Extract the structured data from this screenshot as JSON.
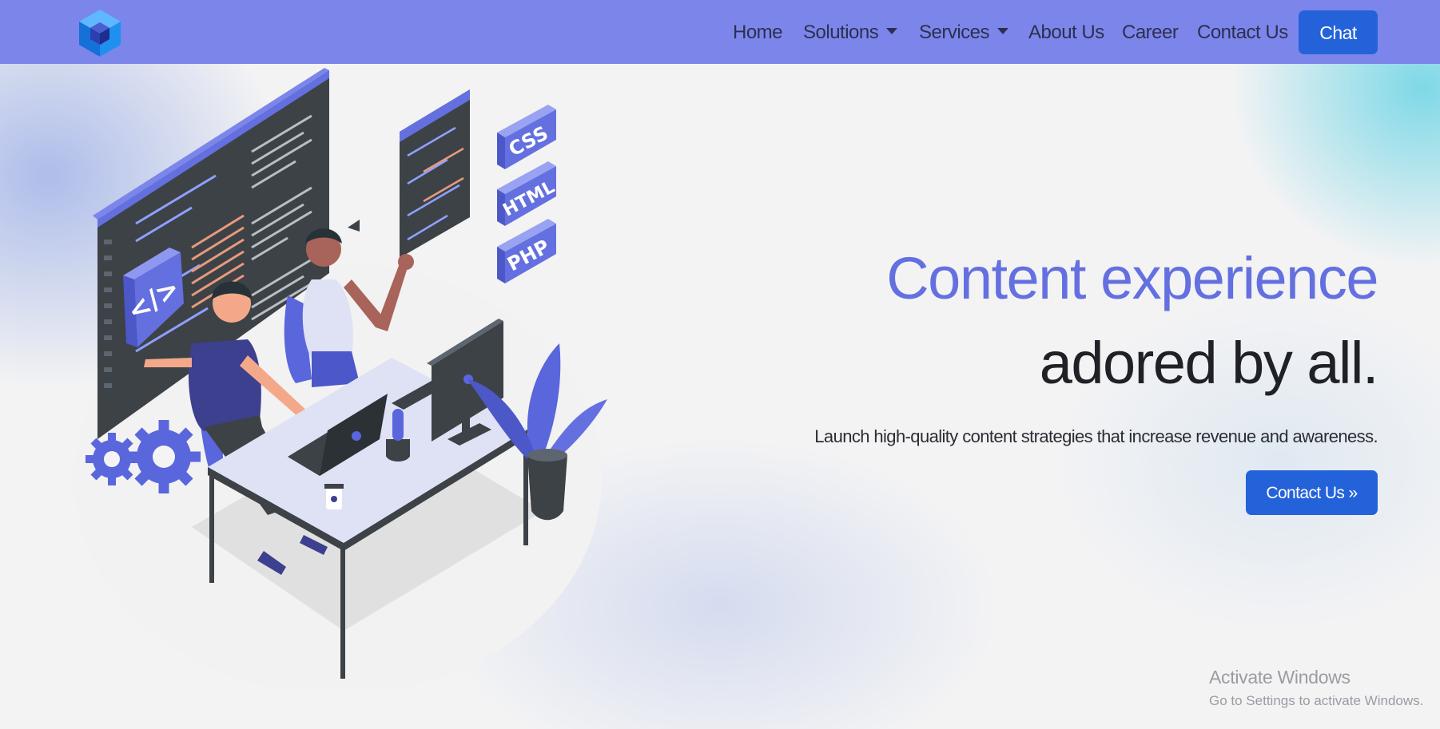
{
  "nav": {
    "links": [
      {
        "label": "Home"
      },
      {
        "label": "Solutions"
      },
      {
        "label": "Services"
      },
      {
        "label": "About Us"
      },
      {
        "label": "Career"
      },
      {
        "label": "Contact Us"
      }
    ],
    "chat_label": "Chat"
  },
  "hero": {
    "heading_line1": "Content experience",
    "heading_line2": "adored by all.",
    "subtext": "Launch high-quality content strategies that increase revenue and awareness.",
    "cta_label": "Contact Us »"
  },
  "illustration": {
    "tags": [
      "CSS",
      "HTML",
      "PHP"
    ],
    "code_symbol": "</>"
  },
  "watermark": {
    "title": "Activate Windows",
    "subtitle": "Go to Settings to activate Windows."
  },
  "colors": {
    "navbar": "#7c86ea",
    "button": "#2462d9",
    "accent_heading": "#6470e0",
    "dark_heading": "#1f2126"
  },
  "icons": [
    "cube-logo-icon",
    "chevron-down-icon"
  ]
}
